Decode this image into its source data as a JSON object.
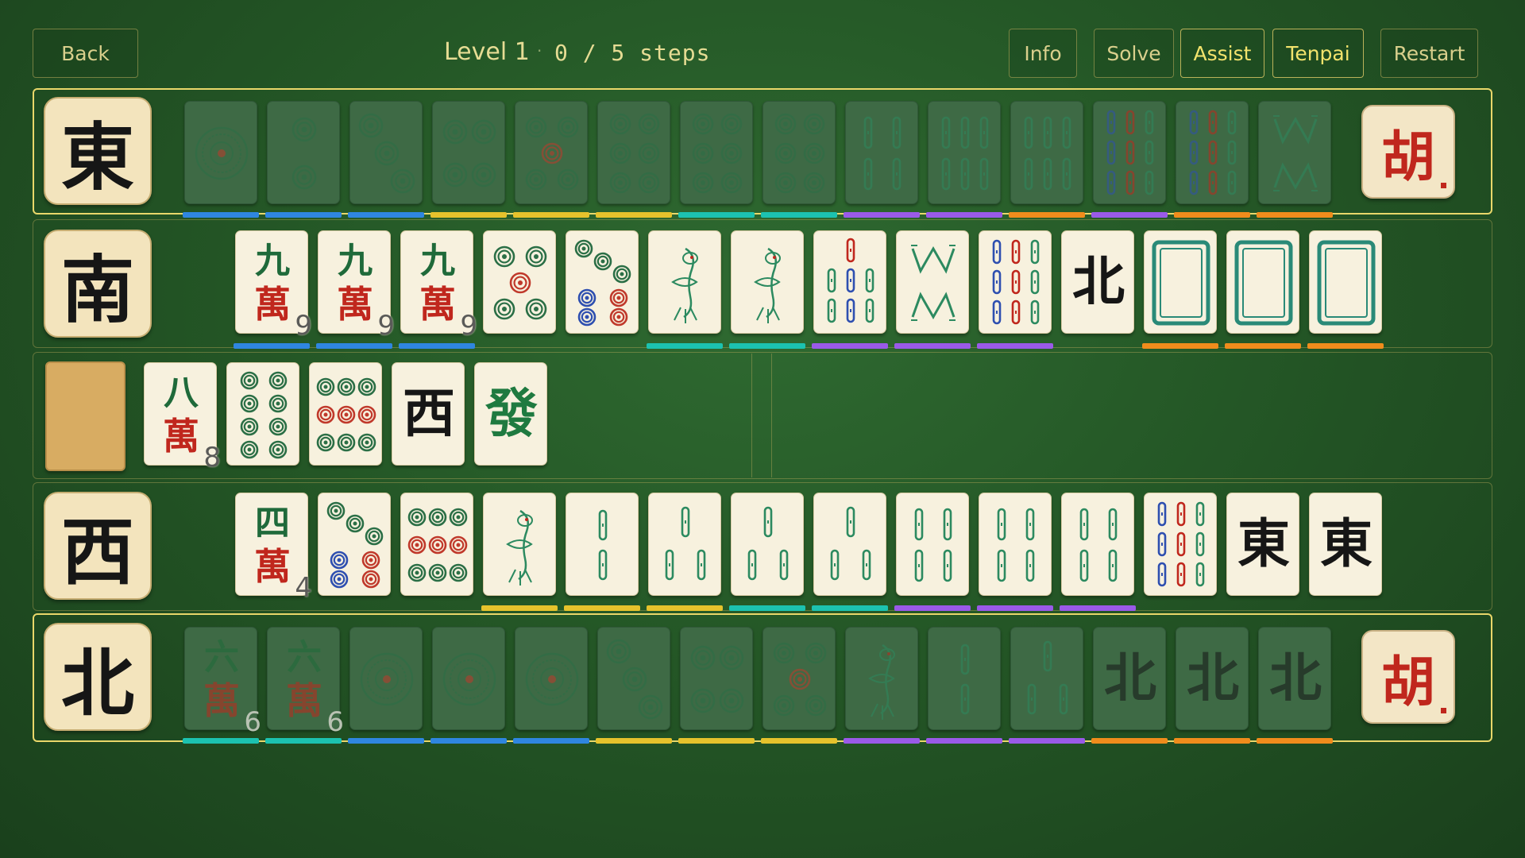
{
  "header": {
    "back_label": "Back",
    "level": "Level 1",
    "separator": "·",
    "steps": "0 / 5 steps",
    "buttons": {
      "info": "Info",
      "solve": "Solve",
      "assist": "Assist",
      "tenpai": "Tenpai",
      "restart": "Restart"
    }
  },
  "colors": {
    "blue": "#2f86e0",
    "yellow": "#e6c22c",
    "teal": "#1cc2b0",
    "purple": "#9a5ae8",
    "orange": "#f08c1c",
    "dots_green": "#2b6f46",
    "dots_red": "#c0392b",
    "bamboo_green": "#2c8a60",
    "bamboo_blue": "#2e4fb0",
    "char_red": "#c0271d"
  },
  "rows": {
    "east": {
      "wind": "東",
      "winner_tile": "胡",
      "tiles": [
        {
          "icon": "1-circle-tile",
          "dim": true
        },
        {
          "icon": "2-circle-tile",
          "dim": true
        },
        {
          "icon": "3-circle-tile",
          "dim": true
        },
        {
          "icon": "4-circle-tile",
          "dim": true
        },
        {
          "icon": "5-circle-tile",
          "dim": true
        },
        {
          "icon": "6-circle-tile",
          "dim": true
        },
        {
          "icon": "6-circle-tile",
          "dim": true
        },
        {
          "icon": "6-circle-tile",
          "dim": true
        },
        {
          "icon": "4-bamboo-tile",
          "dim": true
        },
        {
          "icon": "6-bamboo-tile",
          "dim": true
        },
        {
          "icon": "6-bamboo-tile",
          "dim": true
        },
        {
          "icon": "9-bamboo-tile",
          "dim": true
        },
        {
          "icon": "9-bamboo-tile",
          "dim": true
        },
        {
          "icon": "8-bamboo-tile",
          "dim": true
        }
      ],
      "bars": [
        "blue",
        "blue",
        "blue",
        "yellow",
        "yellow",
        "yellow",
        "teal",
        "teal",
        "purple",
        "purple",
        "orange",
        "purple",
        "orange",
        "orange"
      ]
    },
    "south": {
      "wind": "南",
      "tiles": [
        {
          "icon": "9-character-tile",
          "top": "九",
          "bottom": "萬",
          "num": "9"
        },
        {
          "icon": "9-character-tile",
          "top": "九",
          "bottom": "萬",
          "num": "9"
        },
        {
          "icon": "9-character-tile",
          "top": "九",
          "bottom": "萬",
          "num": "9"
        },
        {
          "icon": "5-circle-tile"
        },
        {
          "icon": "7-circle-tile"
        },
        {
          "icon": "1-bamboo-tile"
        },
        {
          "icon": "1-bamboo-tile"
        },
        {
          "icon": "7-bamboo-tile"
        },
        {
          "icon": "8-bamboo-tile"
        },
        {
          "icon": "9-bamboo-tile"
        },
        {
          "icon": "north-wind-tile",
          "glyph": "北"
        },
        {
          "icon": "white-dragon-tile"
        },
        {
          "icon": "white-dragon-tile"
        },
        {
          "icon": "white-dragon-tile"
        }
      ],
      "bars": [
        "blue",
        "blue",
        "blue",
        null,
        null,
        "teal",
        "teal",
        "purple",
        "purple",
        "purple",
        null,
        "orange",
        "orange",
        "orange"
      ]
    },
    "hand": {
      "tiles": [
        {
          "icon": "8-character-tile",
          "top": "八",
          "bottom": "萬",
          "num": "8"
        },
        {
          "icon": "8-circle-tile"
        },
        {
          "icon": "9-circle-tile"
        },
        {
          "icon": "west-wind-tile",
          "glyph": "西"
        },
        {
          "icon": "green-dragon-tile",
          "glyph": "發"
        }
      ]
    },
    "west": {
      "wind": "西",
      "tiles": [
        {
          "icon": "4-character-tile",
          "top": "四",
          "bottom": "萬",
          "num": "4"
        },
        {
          "icon": "7-circle-tile"
        },
        {
          "icon": "9-circle-tile"
        },
        {
          "icon": "1-bamboo-tile"
        },
        {
          "icon": "2-bamboo-tile"
        },
        {
          "icon": "3-bamboo-tile"
        },
        {
          "icon": "3-bamboo-tile"
        },
        {
          "icon": "3-bamboo-tile"
        },
        {
          "icon": "4-bamboo-tile"
        },
        {
          "icon": "4-bamboo-tile"
        },
        {
          "icon": "4-bamboo-tile"
        },
        {
          "icon": "9-bamboo-tile"
        },
        {
          "icon": "east-wind-tile",
          "glyph": "東"
        },
        {
          "icon": "east-wind-tile",
          "glyph": "東"
        }
      ],
      "bars": [
        null,
        null,
        null,
        "yellow",
        "yellow",
        "yellow",
        "teal",
        "teal",
        "purple",
        "purple",
        "purple",
        null,
        null,
        null
      ]
    },
    "north": {
      "wind": "北",
      "winner_tile": "胡",
      "tiles": [
        {
          "icon": "6-character-tile",
          "top": "六",
          "bottom": "萬",
          "num": "6",
          "dim": true
        },
        {
          "icon": "6-character-tile",
          "top": "六",
          "bottom": "萬",
          "num": "6",
          "dim": true
        },
        {
          "icon": "1-circle-tile",
          "dim": true
        },
        {
          "icon": "1-circle-tile",
          "dim": true
        },
        {
          "icon": "1-circle-tile",
          "dim": true
        },
        {
          "icon": "3-circle-tile",
          "dim": true
        },
        {
          "icon": "4-circle-tile",
          "dim": true
        },
        {
          "icon": "5-circle-tile",
          "dim": true
        },
        {
          "icon": "1-bamboo-tile",
          "dim": true
        },
        {
          "icon": "2-bamboo-tile",
          "dim": true
        },
        {
          "icon": "3-bamboo-tile",
          "dim": true
        },
        {
          "icon": "north-wind-tile",
          "glyph": "北",
          "dim": true
        },
        {
          "icon": "north-wind-tile",
          "glyph": "北",
          "dim": true
        },
        {
          "icon": "north-wind-tile",
          "glyph": "北",
          "dim": true
        }
      ],
      "bars": [
        "teal",
        "teal",
        "blue",
        "blue",
        "blue",
        "yellow",
        "yellow",
        "yellow",
        "purple",
        "purple",
        "purple",
        "orange",
        "orange",
        "orange"
      ]
    }
  }
}
